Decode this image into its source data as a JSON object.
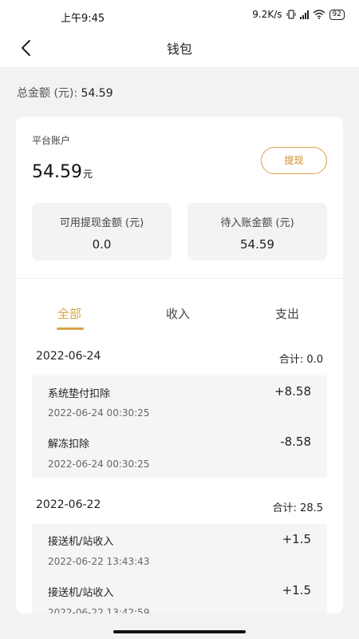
{
  "status": {
    "time": "上午9:45",
    "net": "9.2K/s",
    "battery": "92"
  },
  "nav": {
    "title": "钱包"
  },
  "summary": {
    "label": "总金额 (元):",
    "value": "54.59"
  },
  "account": {
    "label": "平台账户",
    "balance": "54.59",
    "unit": "元",
    "withdraw_label": "提现",
    "available_label": "可用提现金额 (元)",
    "available_value": "0.0",
    "pending_label": "待入账金额 (元)",
    "pending_value": "54.59"
  },
  "tabs": {
    "all": "全部",
    "income": "收入",
    "expense": "支出"
  },
  "groups": [
    {
      "date": "2022-06-24",
      "total": "合计: 0.0",
      "records": [
        {
          "title": "系统垫付扣除",
          "amount": "+8.58",
          "time": "2022-06-24 00:30:25"
        },
        {
          "title": "解冻扣除",
          "amount": "-8.58",
          "time": "2022-06-24 00:30:25"
        }
      ]
    },
    {
      "date": "2022-06-22",
      "total": "合计: 28.5",
      "records": [
        {
          "title": "接送机/站收入",
          "amount": "+1.5",
          "time": "2022-06-22 13:43:43"
        },
        {
          "title": "接送机/站收入",
          "amount": "+1.5",
          "time": "2022-06-22 13:42:59"
        }
      ]
    }
  ]
}
